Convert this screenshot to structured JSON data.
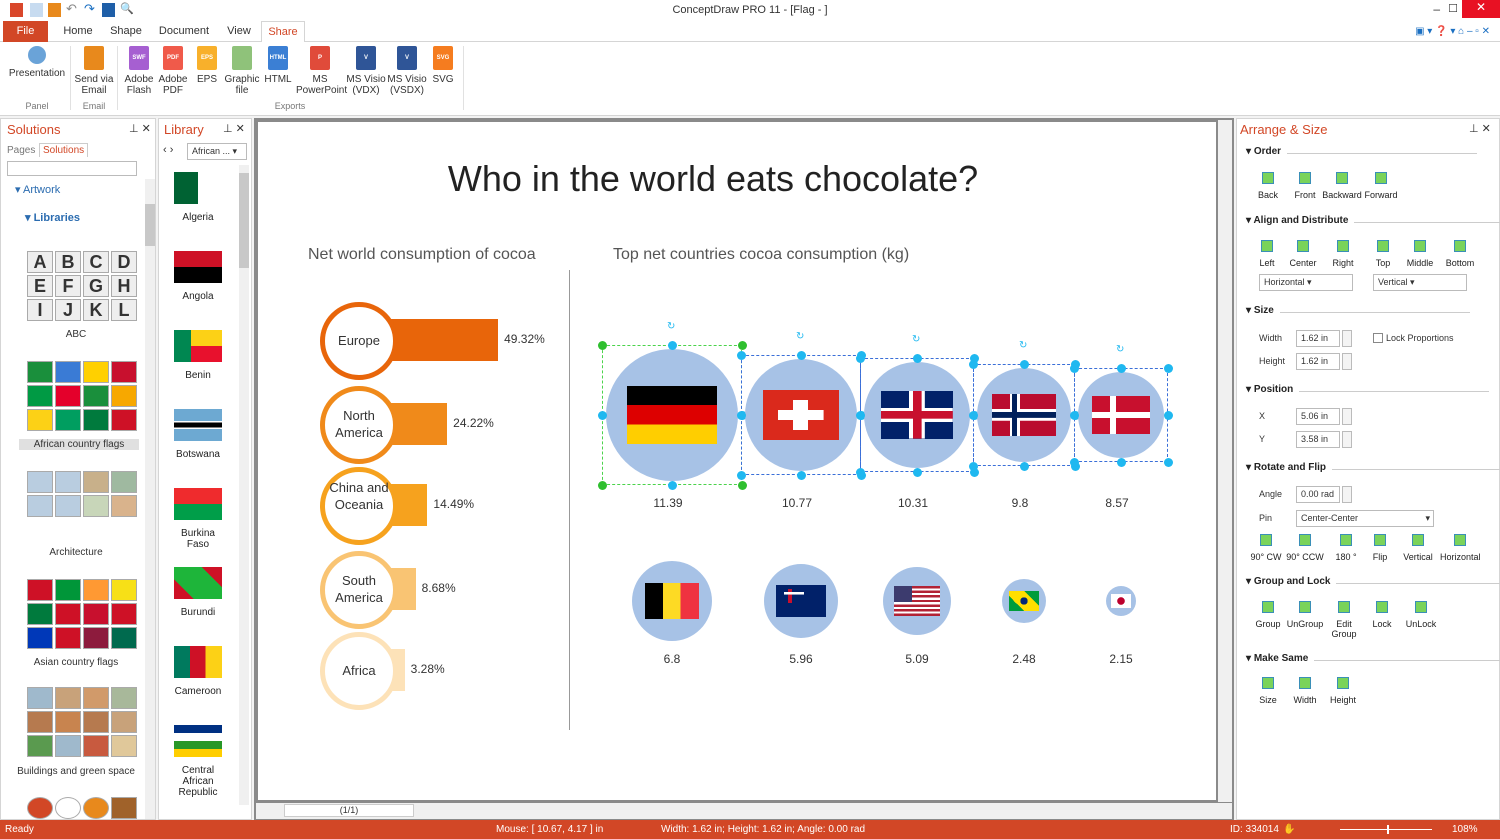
{
  "window": {
    "title": "ConceptDraw PRO 11 - [Flag - ]"
  },
  "tabs": [
    {
      "label": "File"
    },
    {
      "label": "Home"
    },
    {
      "label": "Shape"
    },
    {
      "label": "Document"
    },
    {
      "label": "View"
    },
    {
      "label": "Share"
    }
  ],
  "ribbon": {
    "panel": {
      "label": "Panel",
      "items": [
        {
          "label": "Presentation"
        }
      ]
    },
    "email": {
      "label": "Email",
      "items": [
        {
          "label": "Send via Email"
        }
      ]
    },
    "exports": {
      "label": "Exports",
      "items": [
        {
          "label": "Adobe Flash",
          "tag": "SWF",
          "color": "#a65fd1"
        },
        {
          "label": "Adobe PDF",
          "tag": "PDF",
          "color": "#f05a4a"
        },
        {
          "label": "EPS",
          "tag": "EPS",
          "color": "#f8b02b"
        },
        {
          "label": "Graphic file",
          "tag": "",
          "color": "#8fc27a"
        },
        {
          "label": "HTML",
          "tag": "HTML",
          "color": "#3b7fd4"
        },
        {
          "label": "MS PowerPoint",
          "tag": "P",
          "color": "#e04b3a"
        },
        {
          "label": "MS Visio (VDX)",
          "tag": "V",
          "color": "#2f5597"
        },
        {
          "label": "MS Visio (VSDX)",
          "tag": "V",
          "color": "#2f5597"
        },
        {
          "label": "SVG",
          "tag": "SVG",
          "color": "#f57c1f"
        }
      ]
    }
  },
  "solutions": {
    "title": "Solutions",
    "tabs": [
      "Pages",
      "Solutions"
    ],
    "search_value": "",
    "tree": [
      "Artwork",
      "Libraries"
    ],
    "groups": [
      "ABC",
      "African country flags",
      "Architecture",
      "Asian country flags",
      "Buildings and green space"
    ],
    "abc_letters": [
      "A",
      "B",
      "C",
      "D",
      "E",
      "F",
      "G",
      "H",
      "I",
      "J",
      "K",
      "L"
    ]
  },
  "library": {
    "title": "Library",
    "dropdown": "African ...",
    "items": [
      "Algeria",
      "Angola",
      "Benin",
      "Botswana",
      "Burkina Faso",
      "Burundi",
      "Cameroon",
      "Central African Republic"
    ]
  },
  "canvas": {
    "title": "Who in the world eats chocolate?",
    "left_subtitle": "Net world consumption of cocoa",
    "right_subtitle": "Top net countries cocoa consumption (kg)",
    "page_indicator": "(1/1)"
  },
  "chart_data": [
    {
      "type": "bar",
      "title": "Net world consumption of cocoa",
      "categories": [
        "Europe",
        "North America",
        "China and Oceania",
        "South America",
        "Africa"
      ],
      "values": [
        49.32,
        24.22,
        14.49,
        8.68,
        3.28
      ],
      "labels": [
        "49.32%",
        "24.22%",
        "14.49%",
        "8.68%",
        "3.28%"
      ],
      "colors": [
        "#e8650a",
        "#f08a1a",
        "#f6a21e",
        "#f9c473",
        "#fde2b8"
      ]
    },
    {
      "type": "bubble",
      "title": "Top net countries cocoa consumption (kg)",
      "categories": [
        "Germany",
        "Switzerland",
        "United Kingdom",
        "Norway",
        "Denmark",
        "Belgium",
        "Australia",
        "USA",
        "Brazil",
        "Japan"
      ],
      "values": [
        11.39,
        10.77,
        10.31,
        9.8,
        8.57,
        6.8,
        5.96,
        5.09,
        2.48,
        2.15
      ],
      "labels": [
        "11.39",
        "10.77",
        "10.31",
        "9.8",
        "8.57",
        "6.8",
        "5.96",
        "5.09",
        "2.48",
        "2.15"
      ]
    }
  ],
  "arrange": {
    "title": "Arrange & Size",
    "order": {
      "label": "Order",
      "buttons": [
        "Back",
        "Front",
        "Backward",
        "Forward"
      ]
    },
    "align": {
      "label": "Align and Distribute",
      "buttons": [
        "Left",
        "Center",
        "Right",
        "Top",
        "Middle",
        "Bottom"
      ],
      "horizontal": "Horizontal",
      "vertical": "Vertical"
    },
    "size": {
      "label": "Size",
      "width_label": "Width",
      "width": "1.62 in",
      "height_label": "Height",
      "height": "1.62 in",
      "lock": "Lock Proportions"
    },
    "position": {
      "label": "Position",
      "x_label": "X",
      "x": "5.06 in",
      "y_label": "Y",
      "y": "3.58 in"
    },
    "rotate": {
      "label": "Rotate and Flip",
      "angle_label": "Angle",
      "angle": "0.00 rad",
      "pin_label": "Pin",
      "pin": "Center-Center",
      "buttons": [
        "90° CW",
        "90° CCW",
        "180 °",
        "Flip",
        "Vertical",
        "Horizontal"
      ]
    },
    "group": {
      "label": "Group and Lock",
      "buttons": [
        "Group",
        "UnGroup",
        "Edit Group",
        "Lock",
        "UnLock"
      ]
    },
    "same": {
      "label": "Make Same",
      "buttons": [
        "Size",
        "Width",
        "Height"
      ]
    }
  },
  "status": {
    "ready": "Ready",
    "mouse": "Mouse: [ 10.67, 4.17 ] in",
    "dims": "Width: 1.62 in;  Height: 1.62 in;  Angle: 0.00 rad",
    "id": "ID: 334014",
    "zoom": "108%"
  },
  "colors": {
    "accent": "#d24726",
    "circle": "#a7c2e6",
    "handle": "#1fb8f0"
  }
}
